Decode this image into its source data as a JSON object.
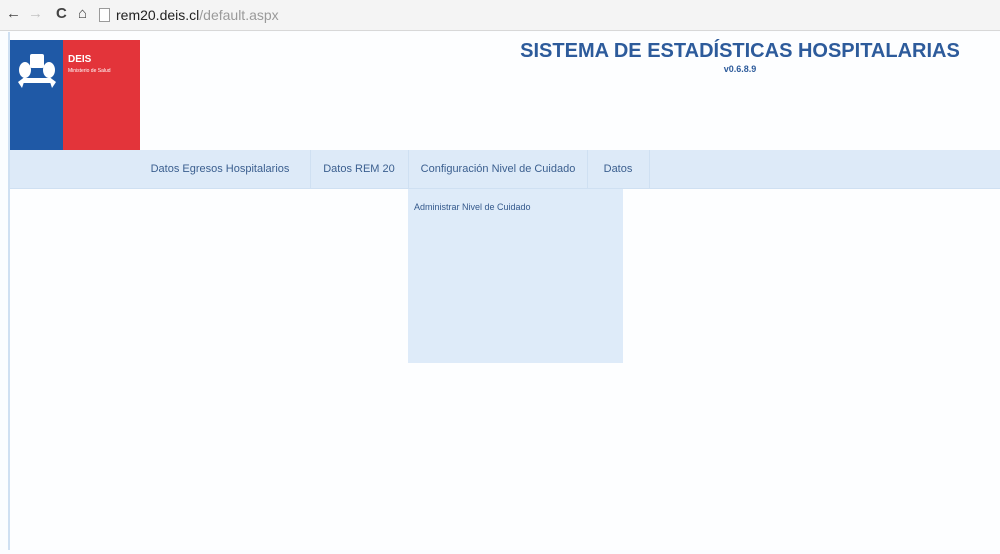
{
  "browser": {
    "back_icon": "←",
    "forward_icon": "→",
    "reload_icon": "C",
    "home_icon": "⌂",
    "url_domain": "rem20.deis.cl",
    "url_path": "/default.aspx"
  },
  "header": {
    "logo_brand": "DEIS",
    "logo_subtitle": "Ministerio de Salud",
    "title": "SISTEMA DE ESTADÍSTICAS HOSPITALARIAS",
    "version": "v0.6.8.9"
  },
  "menu": {
    "items": [
      {
        "label": "Datos Egresos Hospitalarios"
      },
      {
        "label": "Datos REM 20"
      },
      {
        "label": "Configuración Nivel de Cuidado"
      },
      {
        "label": "Datos"
      }
    ],
    "dropdown": {
      "items": [
        {
          "label": "Administrar Nivel de Cuidado"
        }
      ]
    }
  },
  "colors": {
    "title_blue": "#2d5b9b",
    "menu_bg": "#ddeaf8",
    "logo_blue": "#1f59a6",
    "logo_red": "#e3343a"
  }
}
